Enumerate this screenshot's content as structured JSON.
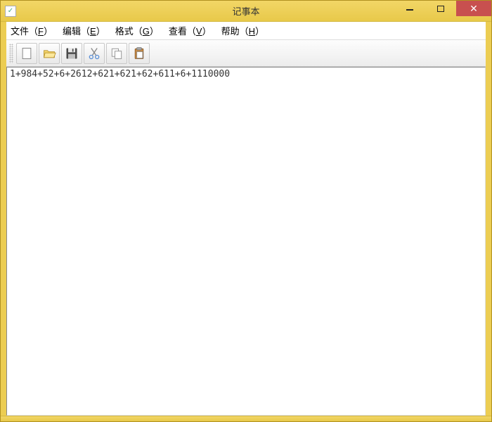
{
  "titlebar": {
    "title": "记事本",
    "icon_name": "notepad-app-icon"
  },
  "window_controls": {
    "minimize_label": "Minimize",
    "maximize_label": "Maximize",
    "close_label": "Close"
  },
  "menubar": {
    "items": [
      {
        "label": "文件",
        "accel": "F"
      },
      {
        "label": "编辑",
        "accel": "E"
      },
      {
        "label": "格式",
        "accel": "G"
      },
      {
        "label": "查看",
        "accel": "V"
      },
      {
        "label": "帮助",
        "accel": "H"
      }
    ]
  },
  "toolbar": {
    "buttons": [
      {
        "name": "new-file-icon"
      },
      {
        "name": "open-file-icon"
      },
      {
        "name": "save-file-icon"
      },
      {
        "name": "cut-icon"
      },
      {
        "name": "copy-icon"
      },
      {
        "name": "paste-icon"
      }
    ]
  },
  "editor": {
    "content": "1+984+52+6+2612+621+621+62+611+6+1110000"
  }
}
